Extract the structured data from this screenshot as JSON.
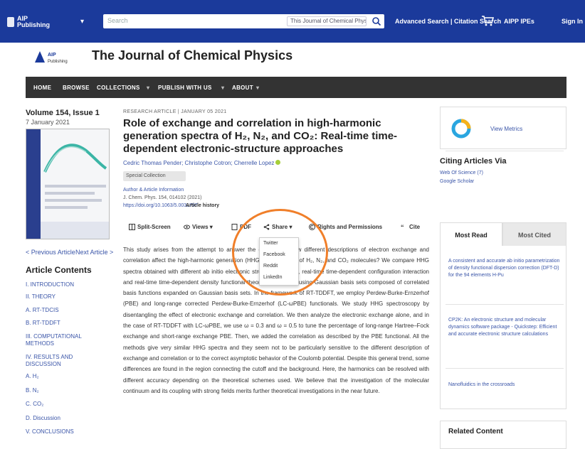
{
  "topbar": {
    "logo_text": "AIP Publishing",
    "search_placeholder": "Search",
    "search_scope": "This Journal of Chemical Physics",
    "advanced_search": "Advanced Search | Citation Search",
    "aipp_ipe": "AIPP IPEs",
    "sign_in": "Sign In"
  },
  "journal": {
    "logo_text": "AIP Publishing",
    "title": "The Journal of Chemical Physics"
  },
  "nav": [
    "HOME",
    "BROWSE",
    "COLLECTIONS",
    "PUBLISH WITH US",
    "ABOUT"
  ],
  "left": {
    "volume": "Volume 154, Issue 1",
    "date": "7 January 2021",
    "prev": "< Previous Article",
    "next": "Next Article >",
    "contents_title": "Article Contents",
    "toc": [
      "I. INTRODUCTION",
      "II. THEORY",
      "A. RT-TDCIS",
      "B. RT-TDDFT",
      "III. COMPUTATIONAL METHODS",
      "IV. RESULTS AND DISCUSSION",
      "A. H₂",
      "B. N₂",
      "C. CO₂",
      "D. Discussion",
      "V. CONCLUSIONS"
    ]
  },
  "article": {
    "breadcrumb": "RESEARCH ARTICLE | JANUARY 05 2021",
    "title": "Role of exchange and correlation in high-harmonic generation spectra of H₂, N₂, and CO₂: Real-time time-dependent electronic-structure approaches",
    "authors": "Cedric Thomas Pender; Christophe Cotron; Cherrelle Lopez",
    "collections_chip": "Special Collection",
    "meta": [
      "Author & Article Information",
      "J. Chem. Phys. 154, 014102 (2021)",
      "https://doi.org/10.1063/5.0031797"
    ],
    "article_history": "Article history",
    "toolbar": [
      "Split-Screen",
      "Views",
      "PDF",
      "Share",
      "Rights and Permissions",
      "Cite"
    ],
    "share_menu": [
      "Twitter",
      "Facebook",
      "Reddit",
      "LinkedIn"
    ],
    "abstract": "This study arises from the attempt to answer the question of how different descriptions of electron exchange and correlation affect the high-harmonic generation (HHG) spectroscopy of H₂, N₂, and CO₂ molecules? We compare HHG spectra obtained with different ab initio electronic structure methods, real-time time-dependent configuration interaction and real-time time-dependent density functional theory (RT-TDDFT) using Gaussian basis sets composed of correlated basis functions expanded on Gaussian basis sets. In the framework of RT-TDDFT, we employ Perdew-Burke-Ernzerhof (PBE) and long-range corrected Perdew-Burke-Ernzerhof (LC-ωPBE) functionals. We study HHG spectroscopy by disentangling the effect of electronic exchange and correlation. We then analyze the electronic exchange alone, and in the case of RT-TDDFT with LC-ωPBE, we use ω = 0.3 and ω = 0.5 to tune the percentage of long-range Hartree–Fock exchange and short-range exchange PBE. Then, we added the correlation as described by the PBE functional. All the methods give very similar HHG spectra and they seem not to be particularly sensitive to the different description of exchange and correlation or to the correct asymptotic behavior of the Coulomb potential. Despite this general trend, some differences are found in the region connecting the cutoff and the background. Here, the harmonics can be resolved with different accuracy depending on the theoretical schemes used. We believe that the investigation of the molecular continuum and its coupling with strong fields merits further theoretical investigations in the near future."
  },
  "right": {
    "metrics_label": "View Metrics",
    "citing_title": "Citing Articles Via",
    "citing_links": [
      "Web Of Science (7)",
      "Google Scholar"
    ],
    "tab_most_read": "Most Read",
    "tab_most_cited": "Most Cited",
    "most_read": [
      "A consistent and accurate ab initio parametrization of density functional dispersion correction (DFT-D) for the 94 elements H-Pu",
      "CP2K: An electronic structure and molecular dynamics software package - Quickstep: Efficient and accurate electronic structure calculations",
      "Nanofluidics in the crossroads"
    ],
    "related": "Related Content"
  },
  "colors": {
    "topbar": "#1b3a9b",
    "nav": "#333333",
    "link": "#3a55a8",
    "highlight": "#f07f2a"
  }
}
